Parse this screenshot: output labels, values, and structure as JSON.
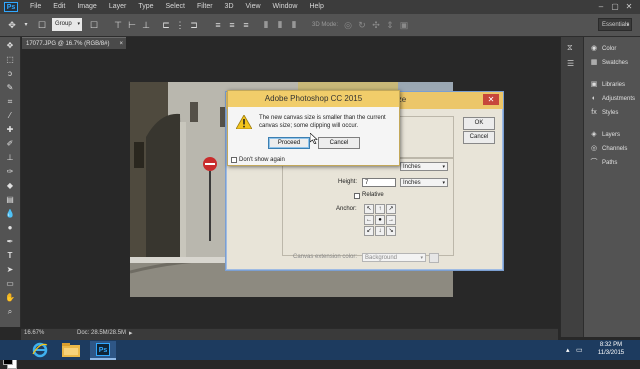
{
  "app": {
    "logo": "Ps",
    "menu": [
      "File",
      "Edit",
      "Image",
      "Layer",
      "Type",
      "Select",
      "Filter",
      "3D",
      "View",
      "Window",
      "Help"
    ]
  },
  "options_bar": {
    "auto_select_value": "Group",
    "mode_3d_label": "3D Mode:",
    "workspace": "Essentials"
  },
  "document": {
    "tab_title": "17077.JPG @ 16.7% (RGB/8#)",
    "zoom": "16.67%",
    "doc_size": "Doc: 28.5M/28.5M"
  },
  "panels": {
    "items": [
      {
        "label": "Color",
        "icon": "color-wheel-icon"
      },
      {
        "label": "Swatches",
        "icon": "swatches-icon"
      },
      {
        "label": "Libraries",
        "icon": "libraries-icon"
      },
      {
        "label": "Adjustments",
        "icon": "adjustments-icon"
      },
      {
        "label": "Styles",
        "icon": "styles-icon"
      },
      {
        "label": "Layers",
        "icon": "layers-icon"
      },
      {
        "label": "Channels",
        "icon": "channels-icon"
      },
      {
        "label": "Paths",
        "icon": "paths-icon"
      }
    ]
  },
  "canvas_size_dialog": {
    "title_fragment": "ize",
    "ok_label": "OK",
    "cancel_label": "Cancel",
    "width_unit": "Inches",
    "height_label": "Height:",
    "height_value": "7",
    "height_unit": "Inches",
    "relative_label": "Relative",
    "anchor_label": "Anchor:",
    "extension_color_label": "Canvas extension color:",
    "extension_color_value": "Background"
  },
  "alert": {
    "title": "Adobe Photoshop CC 2015",
    "message": "The new canvas size is smaller than the current canvas size; some clipping will occur.",
    "proceed_label": "Proceed",
    "cancel_label": "Cancel",
    "dont_show_label": "Don't show again"
  },
  "taskbar": {
    "time": "8:32 PM",
    "date": "11/3/2015"
  },
  "colors": {
    "ui_dark": "#535353",
    "taskbar": "#1d3b5f",
    "win_title": "#f1cd6a",
    "close_red": "#c7473b"
  }
}
